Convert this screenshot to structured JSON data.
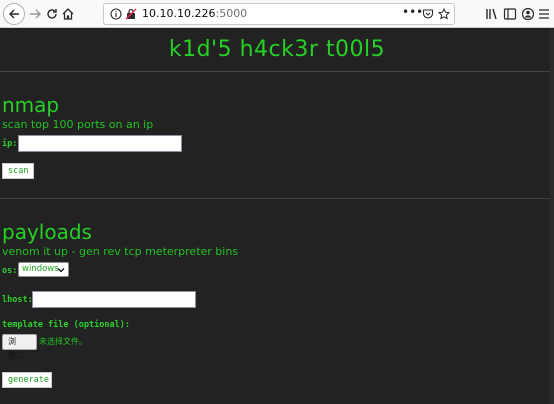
{
  "browser": {
    "url_host": "10.10.10.226",
    "url_port": ":5000"
  },
  "page": {
    "title": "k1d'5 h4ck3r t00l5"
  },
  "nmap": {
    "heading": "nmap",
    "description": "scan top 100 ports on an ip",
    "ip_label": "ip:",
    "ip_value": "",
    "scan_button": "scan"
  },
  "payloads": {
    "heading": "payloads",
    "description": "venom it up - gen rev tcp meterpreter bins",
    "os_label": "os:",
    "os_selected": "windows",
    "lhost_label": "lhost:",
    "lhost_value": "",
    "template_label": "template file (optional):",
    "browse_button": "浏览...",
    "file_status": "未选择文件。",
    "generate_button": "generate"
  },
  "colors": {
    "page_background": "#222222",
    "accent_green": "#26d126"
  }
}
